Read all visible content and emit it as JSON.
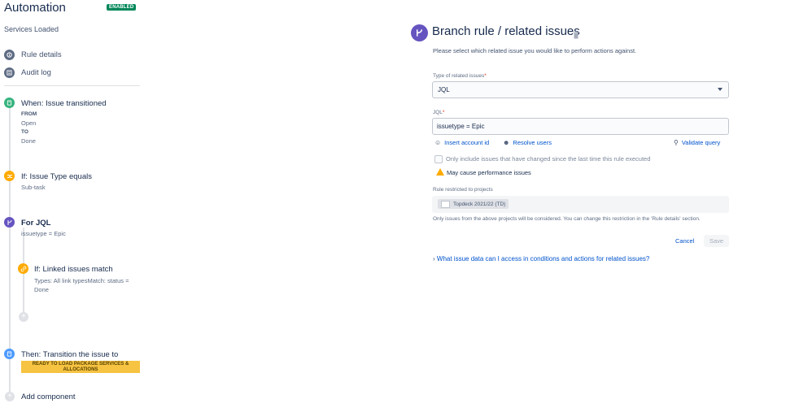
{
  "app": {
    "title": "Automation",
    "status_badge": "ENABLED"
  },
  "rule": {
    "name": "Services Loaded"
  },
  "nav": [
    {
      "label": "Rule details",
      "icon": "info-icon"
    },
    {
      "label": "Audit log",
      "icon": "audit-log-icon"
    }
  ],
  "steps": {
    "trigger": {
      "title": "When: Issue transitioned",
      "from_label": "FROM",
      "from_value": "Open",
      "to_label": "TO",
      "to_value": "Done",
      "color": "#36b37e"
    },
    "condition": {
      "title": "If: Issue Type equals",
      "detail": "Sub-task",
      "color": "#ffab00"
    },
    "branch": {
      "title": "For JQL",
      "detail": "issuetype = Epic",
      "color": "#6554c0"
    },
    "nested_condition": {
      "title": "If: Linked issues match",
      "detail": "Types: All link typesMatch: status = Done",
      "color": "#ffab00"
    },
    "action": {
      "title": "Then: Transition the issue to",
      "status": "READY TO LOAD PACKAGE SERVICES & ALLOCATIONS",
      "color": "#4c9aff"
    },
    "add_component": "Add component"
  },
  "panel": {
    "title": "Branch rule / related issues",
    "description": "Please select which related issue you would like to perform actions against.",
    "type_label": "Type of related issues",
    "type_value": "JQL",
    "jql_label": "JQL",
    "jql_value": "issuetype = Epic",
    "links": {
      "insert_account": "Insert account id",
      "resolve_users": "Resolve users",
      "validate_query": "Validate query"
    },
    "only_include_label": "Only include issues that have changed since the last time this rule executed",
    "warning": "May cause performance issues",
    "restrict_label": "Rule restricted to projects",
    "project_chip": "Topdeck 2021/22 (TD)",
    "restrict_note": "Only issues from the above projects will be considered. You can change this restriction in the 'Rule details' section.",
    "cancel": "Cancel",
    "save": "Save",
    "faq": "What issue data can I access in conditions and actions for related issues?"
  }
}
